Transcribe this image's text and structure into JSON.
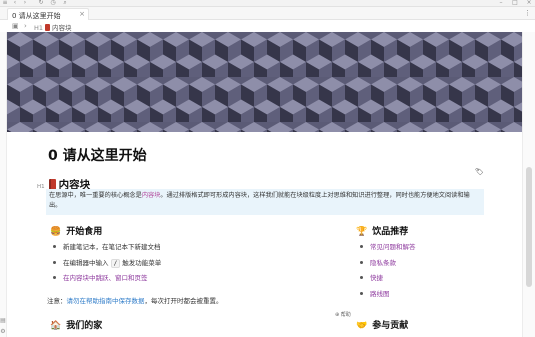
{
  "tab": {
    "label": "0 请从这里开始",
    "close": "×"
  },
  "tabbar_right": "⋮",
  "breadcrumb": {
    "heading_marker": "H1",
    "label": "内容块"
  },
  "page": {
    "title": "0 请从这里开始"
  },
  "section": {
    "heading_marker": "H1",
    "title": "内容块",
    "note_before": "在思源中，唯一重要的核心概念是",
    "note_highlight": "内容块",
    "note_after": "。通过排版格式即可形成内容块，这样我们就能在块级粒度上对思维和知识进行整理，同时也能方便地文阅读和输出。"
  },
  "left": {
    "title": "开始食用",
    "icon": "hamburger-icon",
    "items": [
      {
        "text": "新建笔记本，在笔记本下新建文档"
      },
      {
        "before": "在编辑器中输入 ",
        "code": "/",
        "after": " 触发功能菜单"
      },
      {
        "link": "在内容块中跳跃、窗口和页签"
      }
    ]
  },
  "right": {
    "title": "饮品推荐",
    "icon": "trophy-icon",
    "items": [
      "常见问题和解答",
      "隐私条款",
      "快捷",
      "路线图"
    ]
  },
  "attention": {
    "label": "注意：",
    "link": "请勿在帮助指南中保存数据",
    "after": "，每次打开时都会被重置。"
  },
  "tiny_tag": "⊕ 帮助",
  "bottom": {
    "left_title": "我们的家",
    "right_title": "参与贡献"
  },
  "colors": {
    "accent_link": "#8e3a9e",
    "info_bg": "#e9f4fb",
    "banner": "#4a4a62"
  }
}
